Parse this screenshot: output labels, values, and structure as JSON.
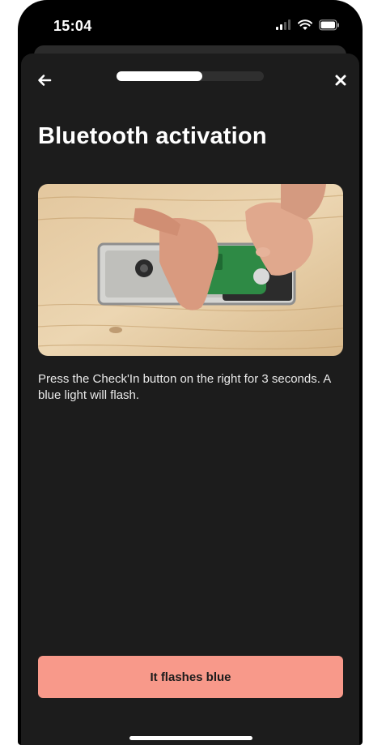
{
  "status_bar": {
    "time": "15:04",
    "icons": [
      "cellular-signal-icon",
      "wifi-icon",
      "battery-icon"
    ]
  },
  "nav": {
    "back_icon": "arrow-left-icon",
    "close_icon": "close-icon",
    "progress": 0.58
  },
  "page": {
    "title": "Bluetooth activation",
    "image_alt": "hands inserting circuit board into a box on a wooden table",
    "instruction": "Press the Check'In button on the right for 3 seconds. A blue light will flash."
  },
  "actions": {
    "primary_label": "It flashes blue"
  },
  "colors": {
    "sheet_background": "#1c1c1c",
    "primary_button": "#f8998a",
    "progress_fill": "#ffffff",
    "progress_track": "#2f2f2f"
  }
}
